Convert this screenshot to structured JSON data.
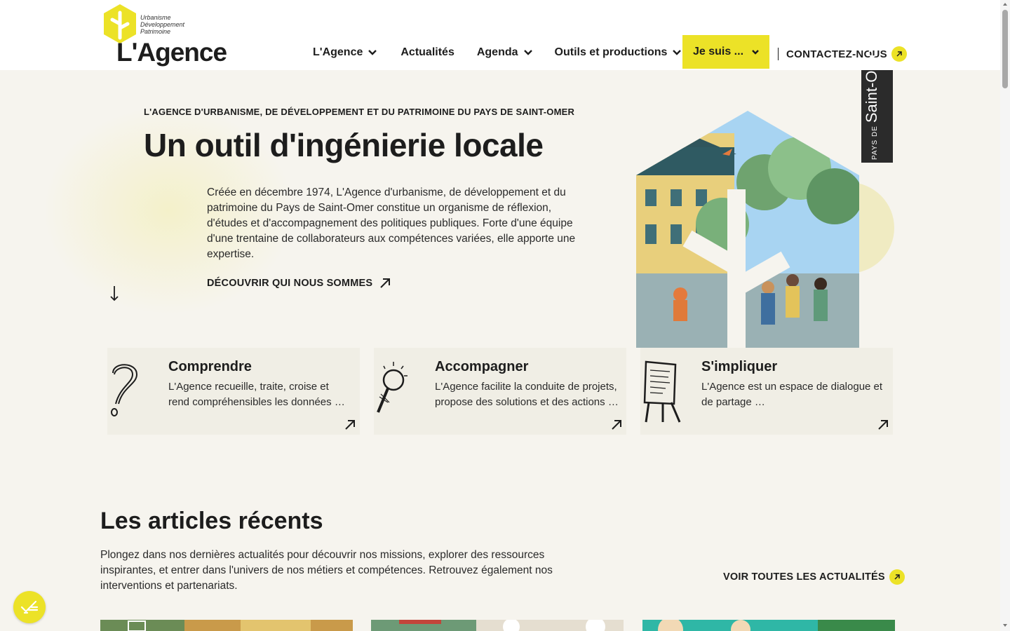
{
  "header": {
    "logo": {
      "tagline": [
        "Urbanisme",
        "Développement",
        "Patrimoine"
      ],
      "name": "L'Agence"
    },
    "nav": [
      {
        "label": "L'Agence",
        "has_dropdown": true
      },
      {
        "label": "Actualités",
        "has_dropdown": false
      },
      {
        "label": "Agenda",
        "has_dropdown": true
      },
      {
        "label": "Outils et productions",
        "has_dropdown": true
      }
    ],
    "je_suis_label": "Je suis ...",
    "contact_label": "CONTACTEZ-NOUS"
  },
  "hero": {
    "kicker": "L'AGENCE D'URBANISME, DE DÉVELOPPEMENT ET DU PATRIMOINE DU PAYS DE SAINT-OMER",
    "title": "Un outil d'ingénierie locale",
    "description": "Créée en décembre 1974, L'Agence d'urbanisme, de développement et du patrimoine du Pays de Saint-Omer constitue un organisme de réflexion, d'études et d'accompagnement des politiques publiques. Forte d'une équipe d'une trentaine de collaborateurs aux compétences variées, elle apporte une expertise.",
    "link_label": "DÉCOUVRIR QUI NOUS SOMMES",
    "badge_small": "PAYS DE",
    "badge_big": "Saint-Omer"
  },
  "cards": [
    {
      "title": "Comprendre",
      "text": "L'Agence recueille, traite, croise et rend compréhensibles les données …",
      "icon": "question-mark-icon"
    },
    {
      "title": "Accompagner",
      "text": "L'Agence facilite la conduite de projets, propose des solutions et des actions …",
      "icon": "magnifier-icon"
    },
    {
      "title": "S'impliquer",
      "text": "L'Agence est un espace de dialogue et de partage …",
      "icon": "easel-icon"
    }
  ],
  "articles": {
    "title": "Les articles récents",
    "description": "Plongez dans nos dernières actualités pour découvrir nos missions, explorer des ressources inspirantes, et entrer dans l'univers de nos métiers et compétences. Retrouvez également nos interventions et partenariats.",
    "all_link": "VOIR TOUTES LES ACTUALITÉS"
  },
  "colors": {
    "accent": "#ece227",
    "text": "#1d1d1d",
    "background": "#f6f4ee",
    "card": "#f0eee5"
  }
}
